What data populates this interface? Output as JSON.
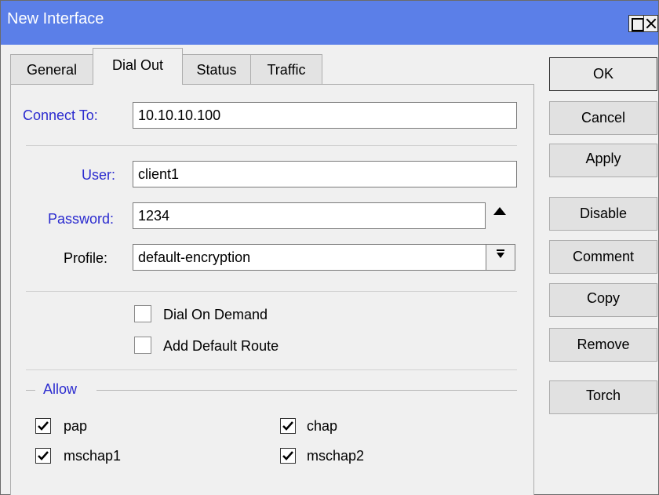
{
  "window": {
    "title": "New Interface"
  },
  "tabs": [
    {
      "label": "General"
    },
    {
      "label": "Dial Out"
    },
    {
      "label": "Status"
    },
    {
      "label": "Traffic"
    }
  ],
  "form": {
    "connect_to": {
      "label": "Connect To:",
      "value": "10.10.10.100"
    },
    "user": {
      "label": "User:",
      "value": "client1"
    },
    "password": {
      "label": "Password:",
      "value": "1234"
    },
    "profile": {
      "label": "Profile:",
      "value": "default-encryption"
    },
    "dial_on_demand": {
      "label": "Dial On Demand",
      "checked": false
    },
    "add_default_route": {
      "label": "Add Default Route",
      "checked": false
    }
  },
  "allow": {
    "title": "Allow",
    "items": [
      {
        "label": "pap",
        "checked": true
      },
      {
        "label": "chap",
        "checked": true
      },
      {
        "label": "mschap1",
        "checked": true
      },
      {
        "label": "mschap2",
        "checked": true
      }
    ]
  },
  "buttons": {
    "ok": "OK",
    "cancel": "Cancel",
    "apply": "Apply",
    "disable": "Disable",
    "comment": "Comment",
    "copy": "Copy",
    "remove": "Remove",
    "torch": "Torch"
  },
  "colors": {
    "titlebar": "#5b7fe8",
    "label_blue": "#2b2bcf",
    "window_bg": "#f0f0f0"
  },
  "icons": {
    "maximize": "maximize-icon",
    "close": "close-icon",
    "password_toggle": "caret-up-icon",
    "profile_dropdown": "dropdown-arrow-icon",
    "checkmark": "checkmark-icon"
  }
}
